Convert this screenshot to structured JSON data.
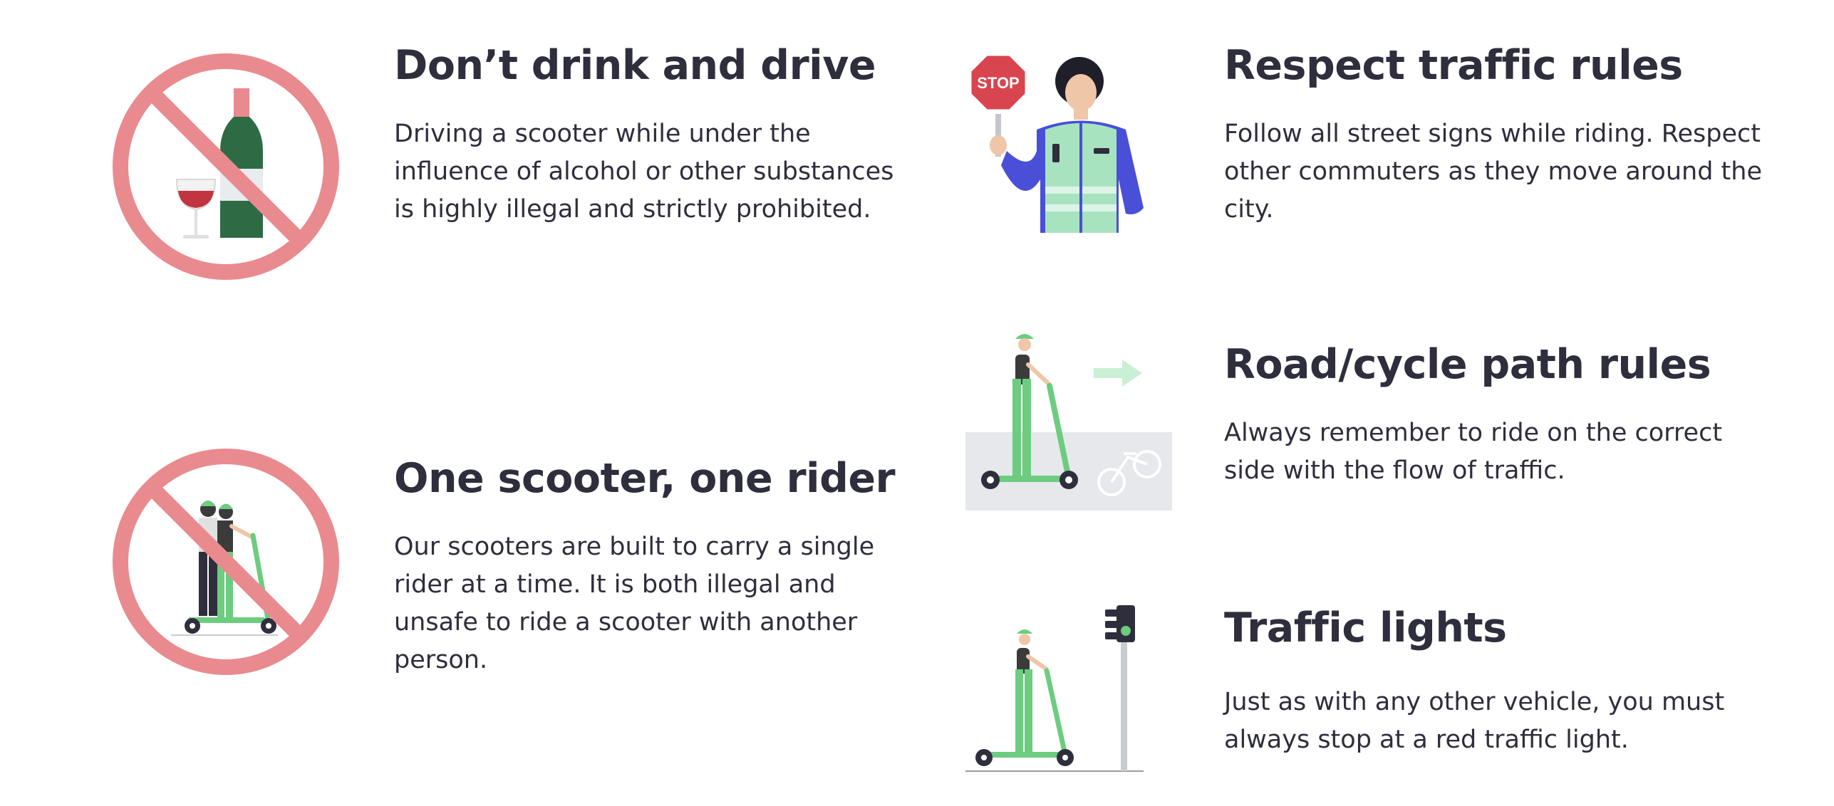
{
  "rules": [
    {
      "title": "Don’t drink and drive",
      "body": "Driving a scooter while under the influence of alcohol or other substances is highly illegal and strictly prohibited."
    },
    {
      "title": "One scooter, one rider",
      "body": "Our scooters are built to carry a single rider at a time. It is both illegal and unsafe to ride a scooter with another person."
    },
    {
      "title": "Respect traffic rules",
      "body": "Follow all street signs while riding. Respect other commuters as they move around the city."
    },
    {
      "title": "Road/cycle path rules",
      "body": "Always remember to ride on the correct side with the flow of traffic."
    },
    {
      "title": "Traffic lights",
      "body": "Just as with any other vehicle, you must always stop at a red traffic light."
    }
  ],
  "icons": {
    "stop_sign_text": "STOP"
  },
  "colors": {
    "prohibition": "#e98a8f",
    "scooter_green": "#6ccc7f",
    "bottle_green": "#2e6b45",
    "stop_red": "#d9454e",
    "vest_mint": "#a8e3c0",
    "jacket_blue": "#4a4fd8",
    "text": "#2e2e3d"
  }
}
